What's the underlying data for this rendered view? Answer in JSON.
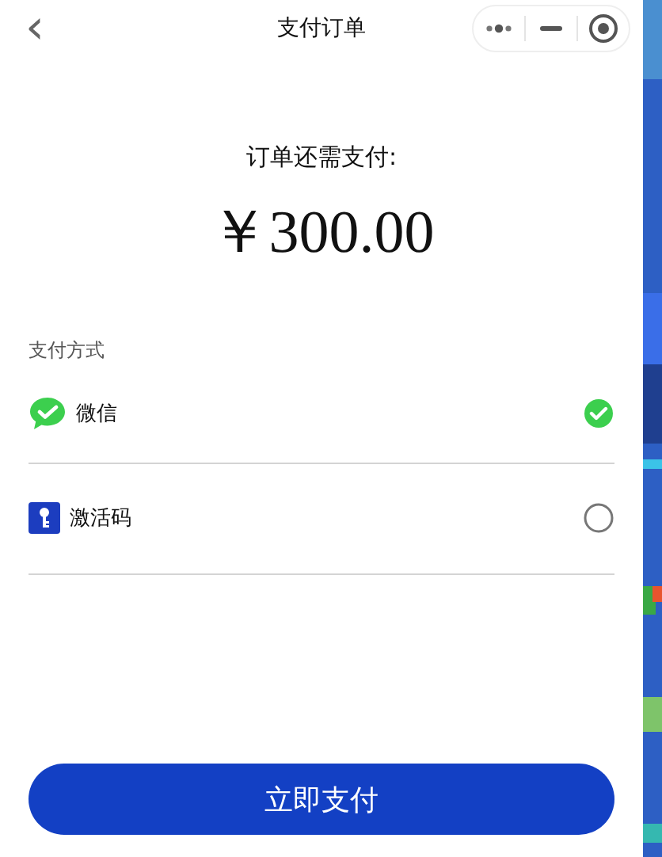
{
  "nav": {
    "back": "‹",
    "title": "支付订单"
  },
  "summary": {
    "label": "订单还需支付:",
    "amount": "￥300.00"
  },
  "payment": {
    "heading": "支付方式",
    "methods": [
      {
        "kind": "wechat",
        "name": "微信",
        "selected": true
      },
      {
        "kind": "key",
        "name": "激活码",
        "selected": false
      }
    ]
  },
  "pay_button": "立即支付"
}
